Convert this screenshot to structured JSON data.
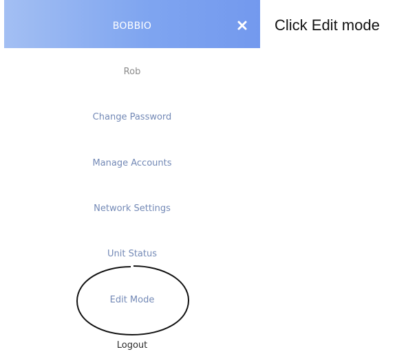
{
  "menu": {
    "title": "BOBBIO",
    "close_icon": "close-icon",
    "user_name": "Rob",
    "items": [
      {
        "id": "change-password",
        "label": "Change Password"
      },
      {
        "id": "manage-accounts",
        "label": "Manage Accounts"
      },
      {
        "id": "network-settings",
        "label": "Network Settings"
      },
      {
        "id": "unit-status",
        "label": "Unit Status"
      },
      {
        "id": "edit-mode",
        "label": "Edit Mode"
      }
    ],
    "logout_label": "Logout"
  },
  "annotation": {
    "instruction": "Click Edit mode"
  },
  "colors": {
    "header_gradient_start": "#a3bff3",
    "header_gradient_end": "#7399ee",
    "menu_item": "#7389b6",
    "user_name": "#8a8a8a",
    "logout": "#2a2a2a"
  }
}
